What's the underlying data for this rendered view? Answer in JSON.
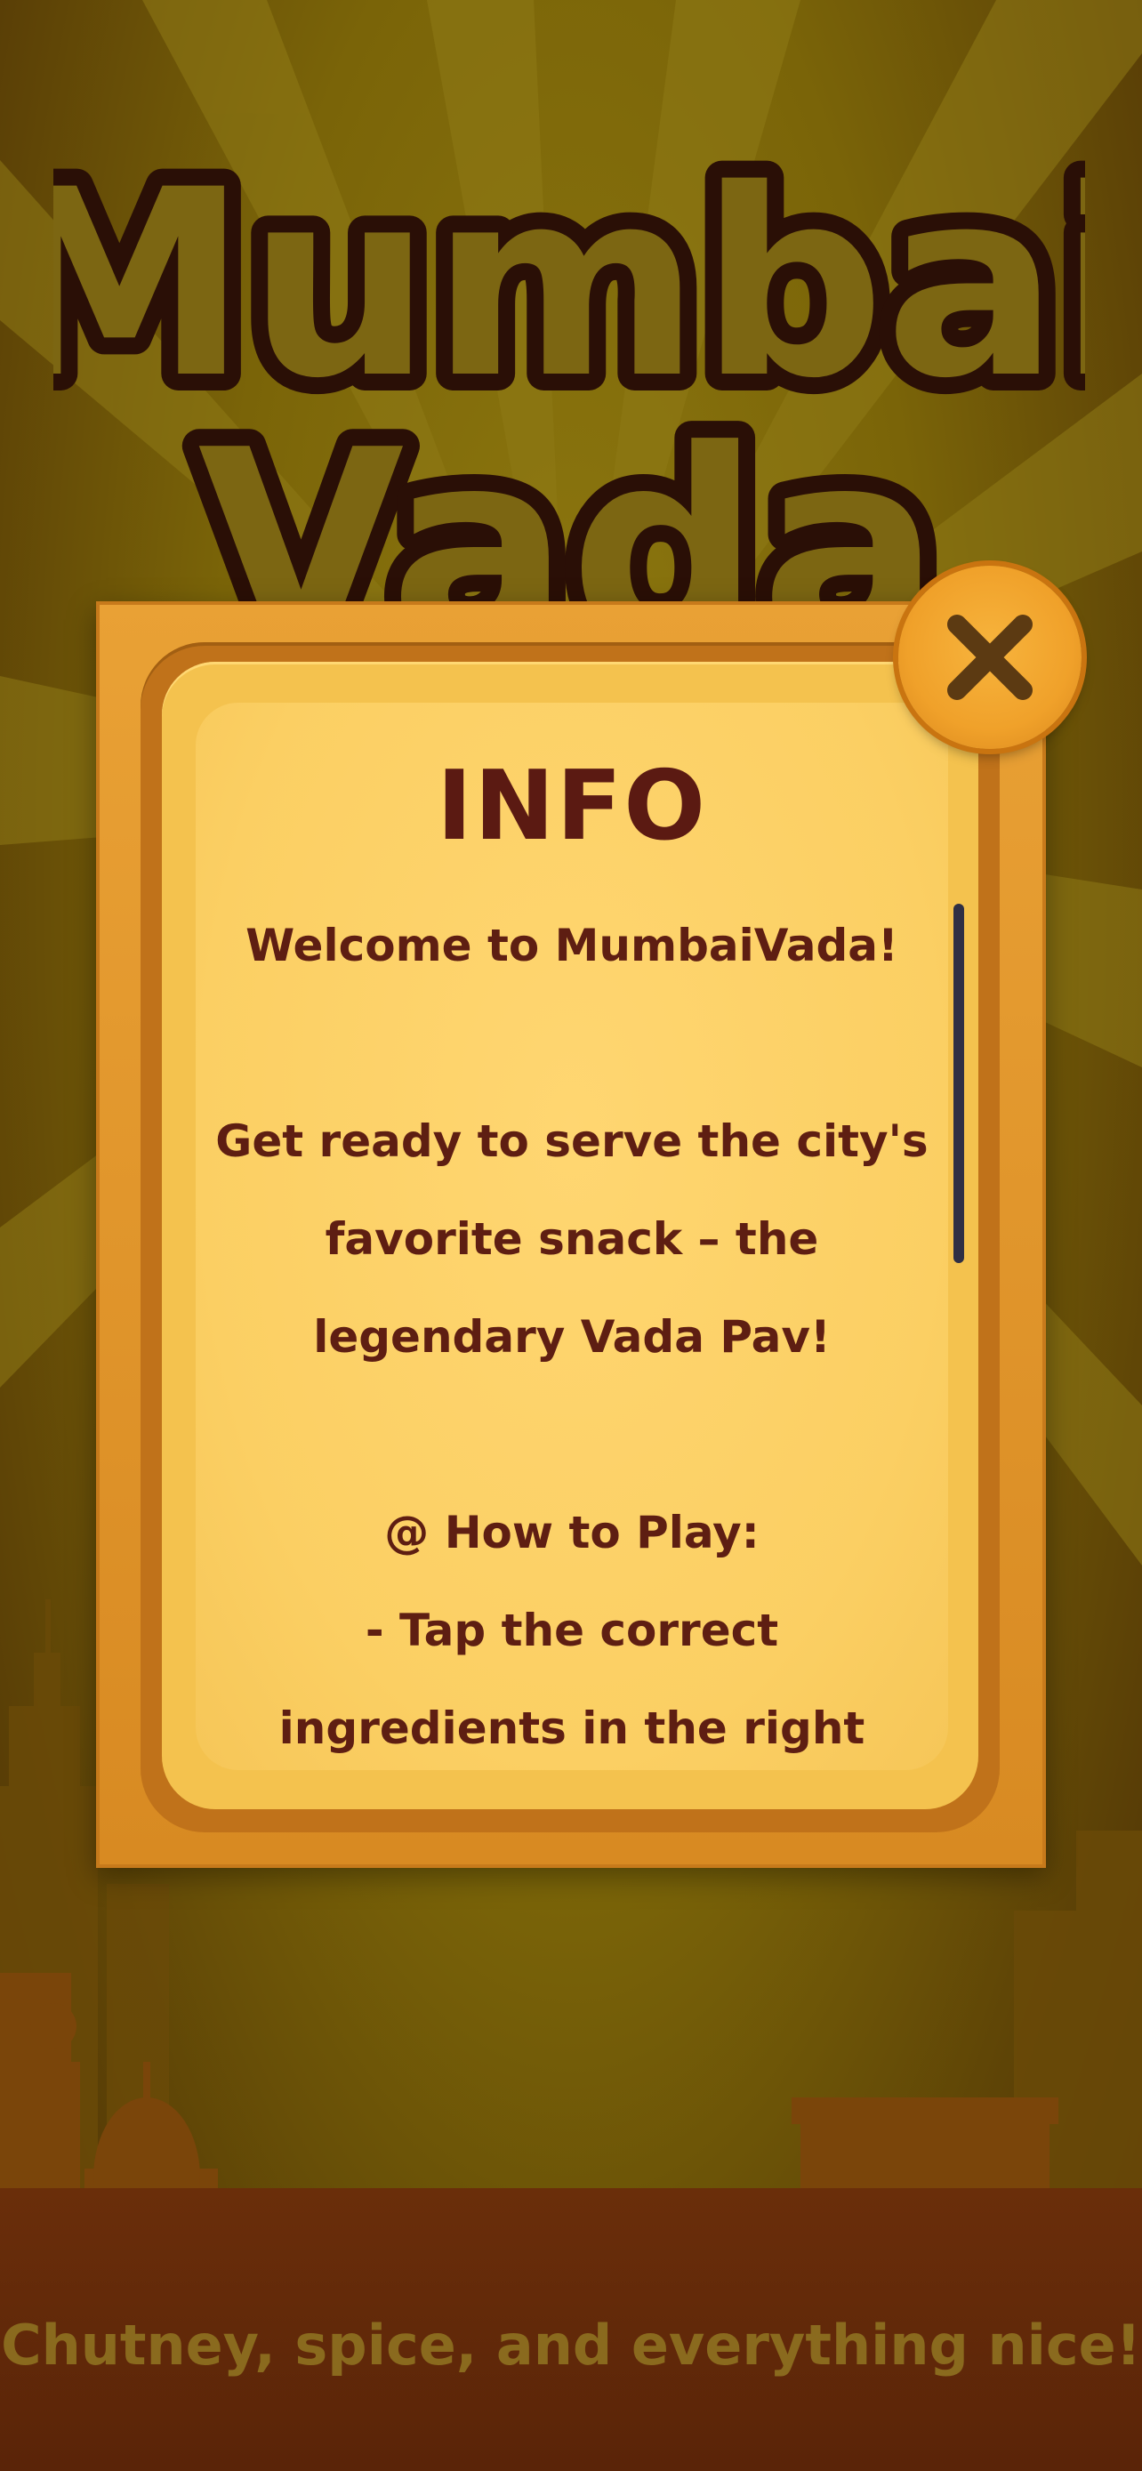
{
  "game": {
    "title_line1": "Mumbai",
    "title_line2": "Vada"
  },
  "info_modal": {
    "title": "INFO",
    "lines": [
      "Welcome to MumbaiVada!",
      "",
      "Get ready to serve the city's",
      "favorite snack – the",
      "legendary Vada Pav!",
      "",
      "@ How to Play:",
      "- Tap the correct",
      "ingredients in the right"
    ],
    "close_icon": "close-x-icon"
  },
  "footer": {
    "tagline": "Chutney, spice, and everything nice!"
  },
  "colors": {
    "background": "#7a6408",
    "modal_frame": "#e39a2e",
    "panel": "#fbcf63",
    "text": "#5b1a12",
    "close_button": "#f0a12a"
  }
}
